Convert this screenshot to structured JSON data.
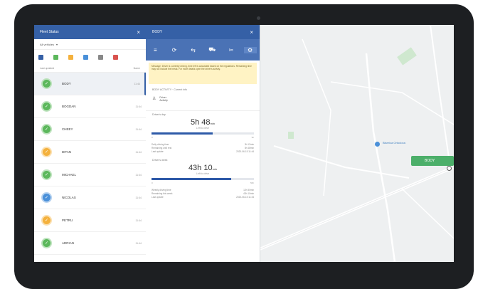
{
  "fleet_panel": {
    "title": "Fleet Status",
    "close": "×",
    "filter": "All vehicles",
    "sort_left": "Last updated",
    "sort_right": "Name",
    "vehicles": [
      {
        "name": "BODY",
        "time": "11:44",
        "color": "#5cb85c",
        "selected": true
      },
      {
        "name": "BOGDAN",
        "time": "11:44",
        "color": "#5cb85c",
        "selected": false
      },
      {
        "name": "CHEEY",
        "time": "11:44",
        "color": "#5cb85c",
        "selected": false
      },
      {
        "name": "DITAN",
        "time": "11:44",
        "color": "#f4b13d",
        "selected": false
      },
      {
        "name": "MICHAEL",
        "time": "11:44",
        "color": "#5cb85c",
        "selected": false
      },
      {
        "name": "NICOLAS",
        "time": "11:44",
        "color": "#4a90d9",
        "selected": false
      },
      {
        "name": "PETRU",
        "time": "11:44",
        "color": "#f4b13d",
        "selected": false
      },
      {
        "name": "ADRIAN",
        "time": "11:44",
        "color": "#5cb85c",
        "selected": false
      }
    ]
  },
  "detail_panel": {
    "title": "BODY",
    "close": "×",
    "tools": [
      "≡",
      "⟳",
      "⇆",
      "⛟",
      "✂",
      "⚙"
    ],
    "banner": "Message: Driver is currently driving, time left is calculated based on the regulations. Remaining time may not include the break. For more details open the driver's activity.",
    "section_driver": "BODY ACTIVITY · Current info",
    "driver_line1": "Driver",
    "driver_line2": "Activity",
    "driving_label": "Driver's day",
    "driving_time": "5h 48",
    "driving_unit": "min",
    "driving_sub": "Left to drive",
    "week_label": "Driver's week",
    "week_time": "43h 10",
    "week_unit": "min",
    "week_sub": "Left to drive",
    "tick_start": "0",
    "tick_end": "9h",
    "week_tick_start": "0",
    "week_tick_end": "56h",
    "rows": [
      {
        "k": "Daily driving time",
        "v": "3h 12min"
      },
      {
        "k": "Remaining until rest",
        "v": "5h 48min"
      },
      {
        "k": "Last update",
        "v": "2020-06-15 11:44"
      }
    ],
    "week_rows": [
      {
        "k": "Weekly driving time",
        "v": "12h 50min"
      },
      {
        "k": "Remaining this week",
        "v": "43h 10min"
      },
      {
        "k": "Last update",
        "v": "2020-06-15 11:44"
      }
    ],
    "progress": {
      "day": 0.6,
      "week": 0.78
    }
  },
  "map": {
    "vehicle_chip": "BODY",
    "poi": "Biserica Ortodoxa"
  }
}
